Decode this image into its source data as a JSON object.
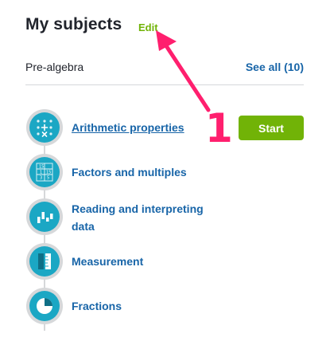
{
  "header": {
    "title": "My subjects",
    "edit_label": "Edit"
  },
  "subject": {
    "name": "Pre-algebra",
    "see_all_label": "See all (10)"
  },
  "skills": [
    {
      "label": "Arithmetic properties",
      "icon": "arithmetic-grid-icon",
      "active": true
    },
    {
      "label": "Factors and multiples",
      "icon": "factors-grid-icon"
    },
    {
      "label": "Reading and interpreting data",
      "label_line1": "Reading and interpreting",
      "label_line2": "data",
      "icon": "bar-data-icon"
    },
    {
      "label": "Measurement",
      "icon": "measurement-icon"
    },
    {
      "label": "Fractions",
      "icon": "pie-fraction-icon"
    }
  ],
  "start_button": {
    "label": "Start"
  },
  "annotation": {
    "number": "1",
    "color": "#ff1f6e"
  },
  "colors": {
    "accent_green": "#71b307",
    "link_blue": "#1865a8",
    "icon_teal": "#1ba7c4",
    "ring_gray": "#d6d8da"
  }
}
